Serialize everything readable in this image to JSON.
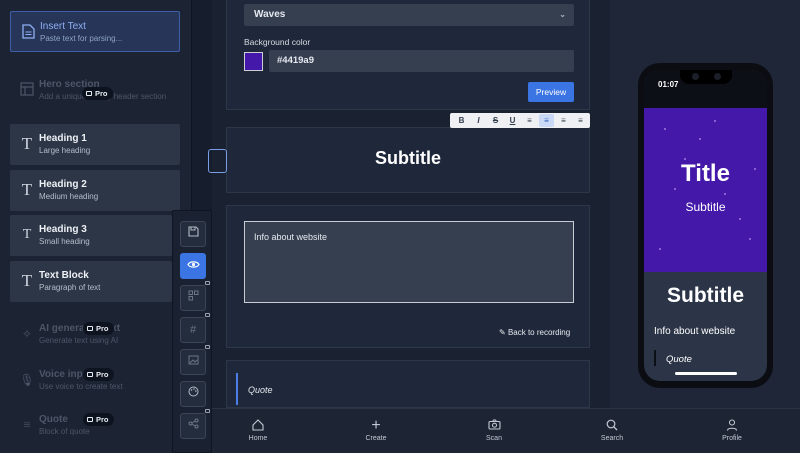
{
  "sidebar": {
    "items": [
      {
        "label": "Insert Text",
        "sub": "Paste text for parsing..."
      },
      {
        "label": "Hero section",
        "sub": "Add a unique catchy header section",
        "badge": "Pro"
      },
      {
        "label": "Heading 1",
        "sub": "Large heading"
      },
      {
        "label": "Heading 2",
        "sub": "Medium heading"
      },
      {
        "label": "Heading 3",
        "sub": "Small heading"
      },
      {
        "label": "Text Block",
        "sub": "Paragraph of text"
      },
      {
        "label": "AI generated text",
        "sub": "Generate text using AI",
        "badge": "Pro"
      },
      {
        "label": "Voice input",
        "sub": "Use voice to create text",
        "badge": "Pro"
      },
      {
        "label": "Quote",
        "sub": "Block of quote",
        "badge": "Pro"
      }
    ]
  },
  "tools": [
    "save-icon",
    "eye-icon",
    "qr-icon",
    "hash-icon",
    "image-icon",
    "palette-icon",
    "share-icon"
  ],
  "editor": {
    "background_style": "Waves",
    "background_color_label": "Background color",
    "background_color": "#4419a9",
    "preview_button": "Preview",
    "format_buttons": [
      "B",
      "I",
      "S",
      "U",
      "≡",
      "≡",
      "≡",
      "≡"
    ],
    "subtitle": "Subtitle",
    "text_value": "Info about website",
    "back_to_recording": "Back to recording",
    "quote": "Quote"
  },
  "phone": {
    "time": "01:07",
    "hero_title": "Title",
    "hero_subtitle": "Subtitle",
    "subtitle": "Subtitle",
    "info": "Info about website",
    "quote": "Quote"
  },
  "nav": [
    {
      "label": "Home",
      "icon": "home-icon"
    },
    {
      "label": "Create",
      "icon": "plus-icon"
    },
    {
      "label": "Scan",
      "icon": "camera-icon"
    },
    {
      "label": "Search",
      "icon": "search-icon"
    },
    {
      "label": "Profile",
      "icon": "user-icon"
    }
  ]
}
